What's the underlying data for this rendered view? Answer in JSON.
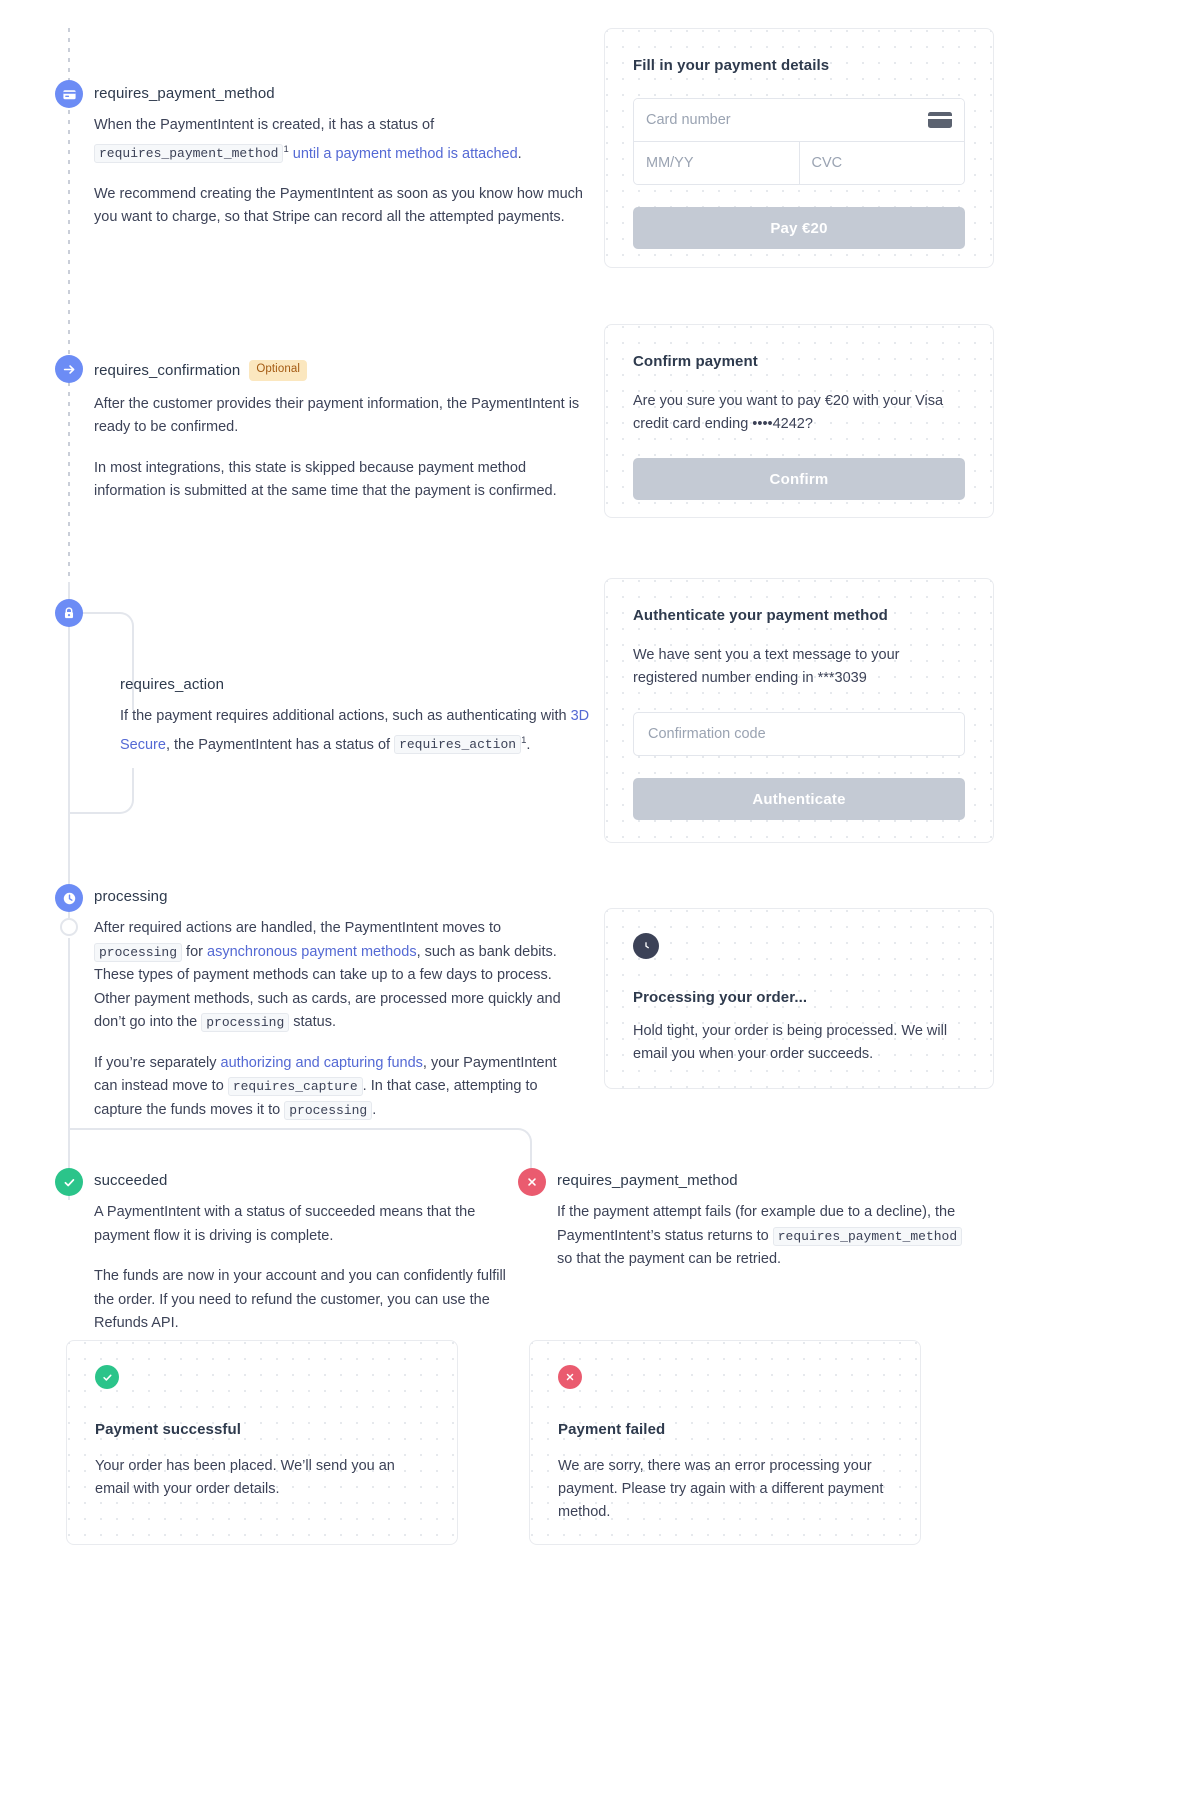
{
  "steps": [
    {
      "id": "requires_payment_method",
      "icon": "credit-card-icon",
      "title": "requires_payment_method",
      "badge": null,
      "paragraphs": [
        "When the PaymentIntent is created, it has a status of",
        "We recommend creating the PaymentIntent as soon as you know how much you want to charge, so that Stripe can record all the attempted payments."
      ],
      "inline": {
        "code": "requires_payment_method",
        "sup": "1",
        "link": "until a payment method is attached",
        "tail": "."
      }
    },
    {
      "id": "requires_confirmation",
      "icon": "arrow-right-icon",
      "title": "requires_confirmation",
      "badge": "Optional",
      "paragraphs": [
        "After the customer provides their payment information, the PaymentIntent is ready to be confirmed.",
        "In most integrations, this state is skipped because payment method information is submitted at the same time that the payment is confirmed."
      ]
    },
    {
      "id": "requires_action",
      "icon": "lock-icon",
      "title": "requires_action",
      "badge": null,
      "text_before_link": "If the payment requires additional actions, such as authenticating with ",
      "link": "3D Secure",
      "text_after_link": ", the PaymentIntent has a status of ",
      "code": "requires_action",
      "sup": "1",
      "tail": "."
    },
    {
      "id": "processing",
      "icon": "clock-icon",
      "title": "processing",
      "badge": null,
      "p1": {
        "a": "After required actions are handled, the PaymentIntent moves to ",
        "code1": "processing",
        "b": " for ",
        "link": "asynchronous payment methods",
        "c": ", such as bank debits. These types of payment methods can take up to a few days to process. Other payment methods, such as cards, are processed more quickly and don’t go into the ",
        "code2": "processing",
        "d": " status."
      },
      "p2": {
        "a": "If you’re separately ",
        "link": "authorizing and capturing funds",
        "b": ", your PaymentIntent can instead move to ",
        "code1": "requires_capture",
        "c": ". In that case, attempting to capture the funds moves it to ",
        "code2": "processing",
        "d": "."
      }
    },
    {
      "id": "succeeded",
      "icon": "check-circle-icon",
      "title": "succeeded",
      "badge": null,
      "paragraphs": [
        "A PaymentIntent with a status of succeeded means that the payment flow it is driving is complete.",
        "The funds are now in your account and you can confidently fulfill the order. If you need to refund the customer, you can use the Refunds API."
      ]
    },
    {
      "id": "requires_payment_method_failed",
      "icon": "x-circle-icon",
      "title": "requires_payment_method",
      "badge": null,
      "text_a": "If the payment attempt fails (for example due to a decline), the PaymentIntent’s status returns to ",
      "code": "requires_payment_method",
      "text_b": " so that the payment can be retried."
    }
  ],
  "cards": {
    "payment_details": {
      "heading": "Fill in your payment details",
      "card_number_placeholder": "Card number",
      "expiry_placeholder": "MM/YY",
      "cvc_placeholder": "CVC",
      "button_label": "Pay €20",
      "brand_icon": "card-brand-icon"
    },
    "confirm_payment": {
      "heading": "Confirm payment",
      "body": "Are you sure you want to pay €20 with your Visa credit card ending ••••4242?",
      "button_label": "Confirm"
    },
    "authenticate": {
      "heading": "Authenticate your payment method",
      "body": "We have sent you a text message to your registered number ending in ***3039",
      "input_placeholder": "Confirmation code",
      "button_label": "Authenticate"
    },
    "processing": {
      "icon": "clock-icon",
      "heading": "Processing your order...",
      "body": "Hold tight, your order is being processed. We will email you when your order succeeds."
    },
    "payment_successful": {
      "icon": "check-circle-icon",
      "heading": "Payment successful",
      "body": "Your order has been placed. We’ll send you an email with your order details."
    },
    "payment_failed": {
      "icon": "x-circle-icon",
      "heading": "Payment failed",
      "body": "We are sorry, there was an error processing your payment. Please try again with a different payment method."
    }
  },
  "colors": {
    "node_blue": "#6c8cf5",
    "node_green": "#2bc48a",
    "node_red": "#ea5b6f",
    "link": "#5469d4",
    "badge_bg": "#fbe7bf",
    "badge_text": "#a45a12",
    "button_disabled": "#c4cad4",
    "rail": "#e3e6ec"
  }
}
